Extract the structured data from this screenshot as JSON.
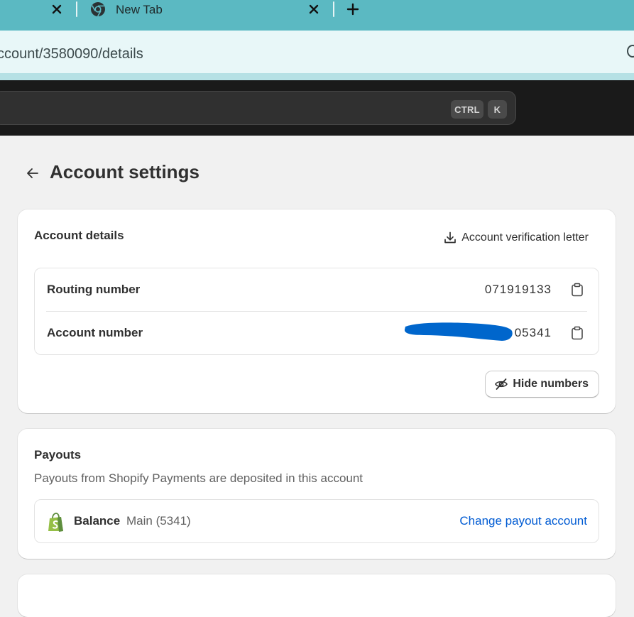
{
  "browser": {
    "tab_title": "New Tab",
    "address": "ccount/3580090/details"
  },
  "topbar": {
    "shortcut_keys": [
      "CTRL",
      "K"
    ]
  },
  "page": {
    "title": "Account settings"
  },
  "account_details": {
    "title": "Account details",
    "verification_letter_label": "Account verification letter",
    "rows": [
      {
        "label": "Routing number",
        "value": "071919133"
      },
      {
        "label": "Account number",
        "value": "05341"
      }
    ],
    "hide_numbers_label": "Hide numbers"
  },
  "payouts": {
    "title": "Payouts",
    "description": "Payouts from Shopify Payments are deposited in this account",
    "balance_name": "Balance",
    "balance_sub": "Main (5341)",
    "change_link": "Change payout account"
  },
  "colors": {
    "tab_strip": "#5bb9c2",
    "address_bar": "#e8f7f8",
    "topbar": "#1a1a1a",
    "link": "#005bd3",
    "redaction": "#0066cc",
    "shopify_green": "#95bf47"
  }
}
